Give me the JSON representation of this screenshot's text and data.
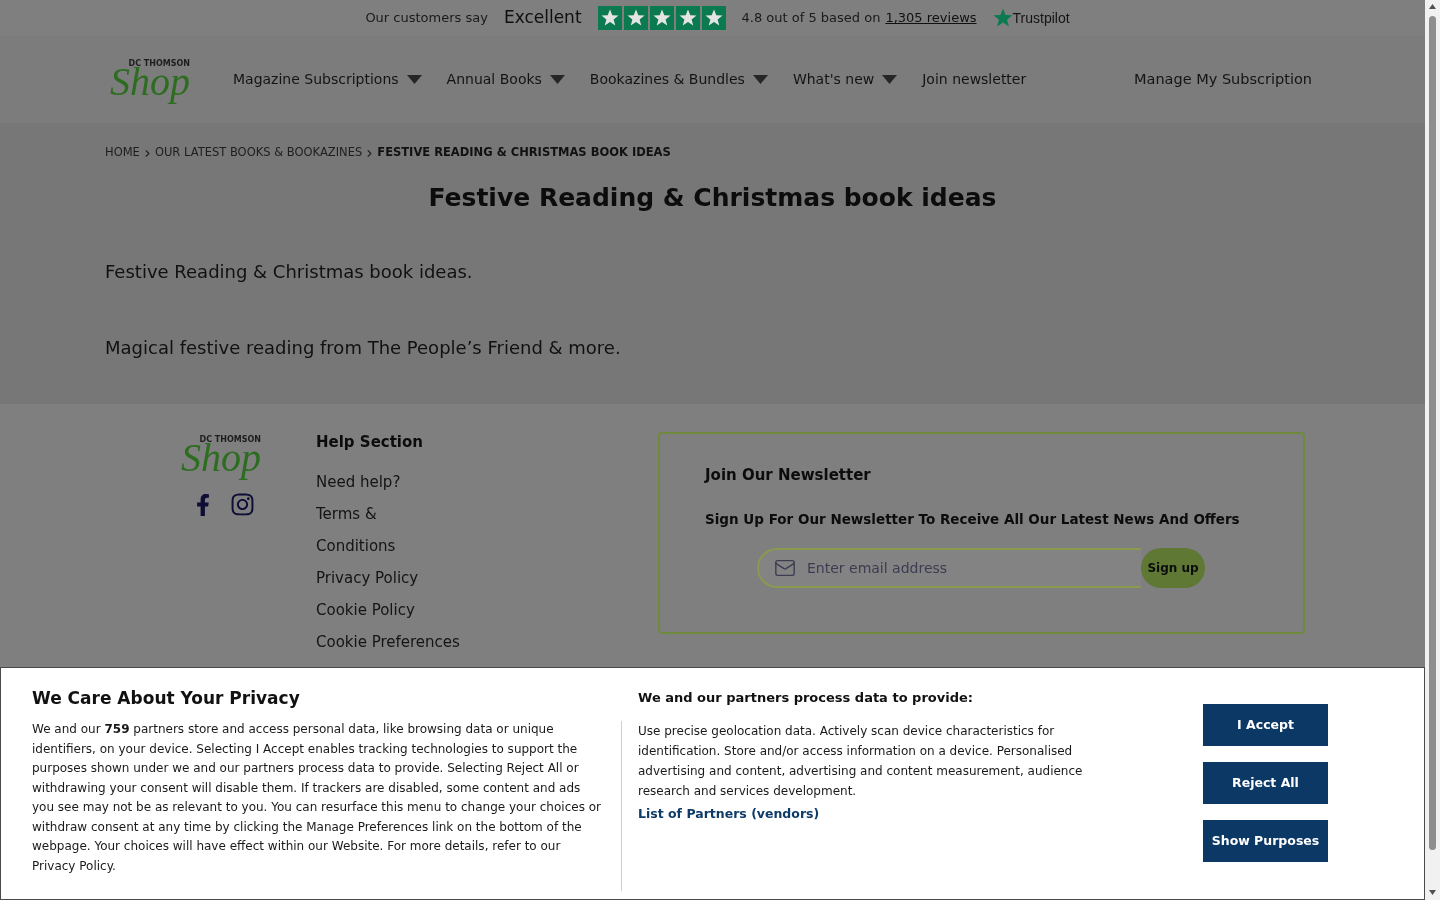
{
  "trustbar": {
    "lead": "Our customers say",
    "rating_word": "Excellent",
    "stars": 5,
    "summary": "4.8 out of 5 based on",
    "reviews_link": "1,305 reviews",
    "brand": "Trustpilot"
  },
  "header": {
    "logo": {
      "tagline": "DC THOMSON",
      "word": "Shop"
    },
    "nav": [
      {
        "label": "Magazine Subscriptions",
        "dropdown": true
      },
      {
        "label": "Annual Books",
        "dropdown": true
      },
      {
        "label": "Bookazines & Bundles",
        "dropdown": true
      },
      {
        "label": "What's new",
        "dropdown": true
      },
      {
        "label": "Join newsletter",
        "dropdown": false
      }
    ],
    "account_link": "Manage My Subscription"
  },
  "breadcrumb": [
    {
      "label": "HOME",
      "current": false
    },
    {
      "label": "OUR LATEST BOOKS & BOOKAZINES",
      "current": false
    },
    {
      "label": "FESTIVE READING & CHRISTMAS BOOK IDEAS",
      "current": true
    }
  ],
  "page": {
    "title": "Festive Reading & Christmas book ideas",
    "paragraphs": [
      "Festive Reading & Christmas book ideas.",
      "Magical festive reading from The People’s Friend & more."
    ]
  },
  "footer": {
    "logo": {
      "tagline": "DC THOMSON",
      "word": "Shop"
    },
    "help": {
      "heading": "Help Section",
      "links": [
        "Need help?",
        "Terms &\nConditions",
        "Privacy Policy",
        "Cookie Policy",
        "Cookie Preferences"
      ]
    },
    "newsletter": {
      "title": "Join Our Newsletter",
      "subtitle": "Sign Up For Our Newsletter To Receive All Our Latest News And Offers",
      "email": {
        "placeholder": "Enter email address"
      },
      "button": "Sign up"
    }
  },
  "cookie_banner": {
    "title": "We Care About Your Privacy",
    "body": "We and our **759** partners store and access personal data, like browsing data or unique identifiers, on your device. Selecting I Accept enables tracking technologies to support the purposes shown under we and our partners process data to provide. Selecting Reject All or withdrawing your consent will disable them. If trackers are disabled, some content and ads you see may not be as relevant to you. You can resurface this menu to change your choices or withdraw consent at any time by clicking the Manage Preferences link on the bottom of the webpage. Your choices will have effect within our Website. For more details, refer to our Privacy Policy.",
    "purposes_heading": "We and our partners process data to provide:",
    "purposes_text": "Use precise geolocation data. Actively scan device characteristics for identification. Store and/or access information on a device. Personalised advertising and content, advertising and content measurement, audience research and services development.",
    "partners_link": "List of Partners (vendors)",
    "buttons": [
      "I Accept",
      "Reject All",
      "Show Purposes"
    ]
  }
}
